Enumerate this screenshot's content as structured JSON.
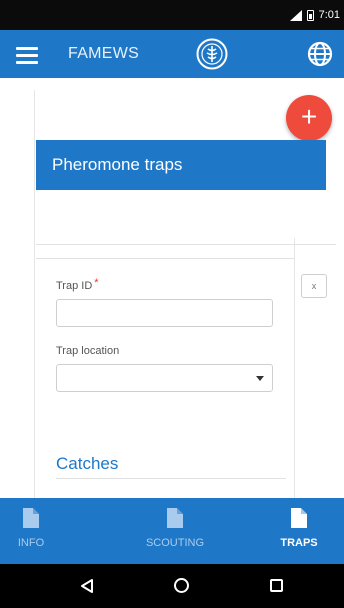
{
  "status_bar": {
    "time": "7:01"
  },
  "app_bar": {
    "title": "FAMEWS"
  },
  "page": {
    "title": "Pheromone traps",
    "fab_label": "+"
  },
  "form": {
    "close_label": "x",
    "trap_id": {
      "label": "Trap ID",
      "required_mark": "*",
      "value": ""
    },
    "trap_location": {
      "label": "Trap location",
      "selected": ""
    },
    "catches_title": "Catches"
  },
  "bottom_nav": {
    "items": [
      {
        "label": "INFO",
        "active": false
      },
      {
        "label": "SCOUTING",
        "active": false
      },
      {
        "label": "TRAPS",
        "active": true
      }
    ]
  },
  "colors": {
    "primary": "#1f78c7",
    "fab": "#ef4b3c",
    "required": "#e53935"
  }
}
